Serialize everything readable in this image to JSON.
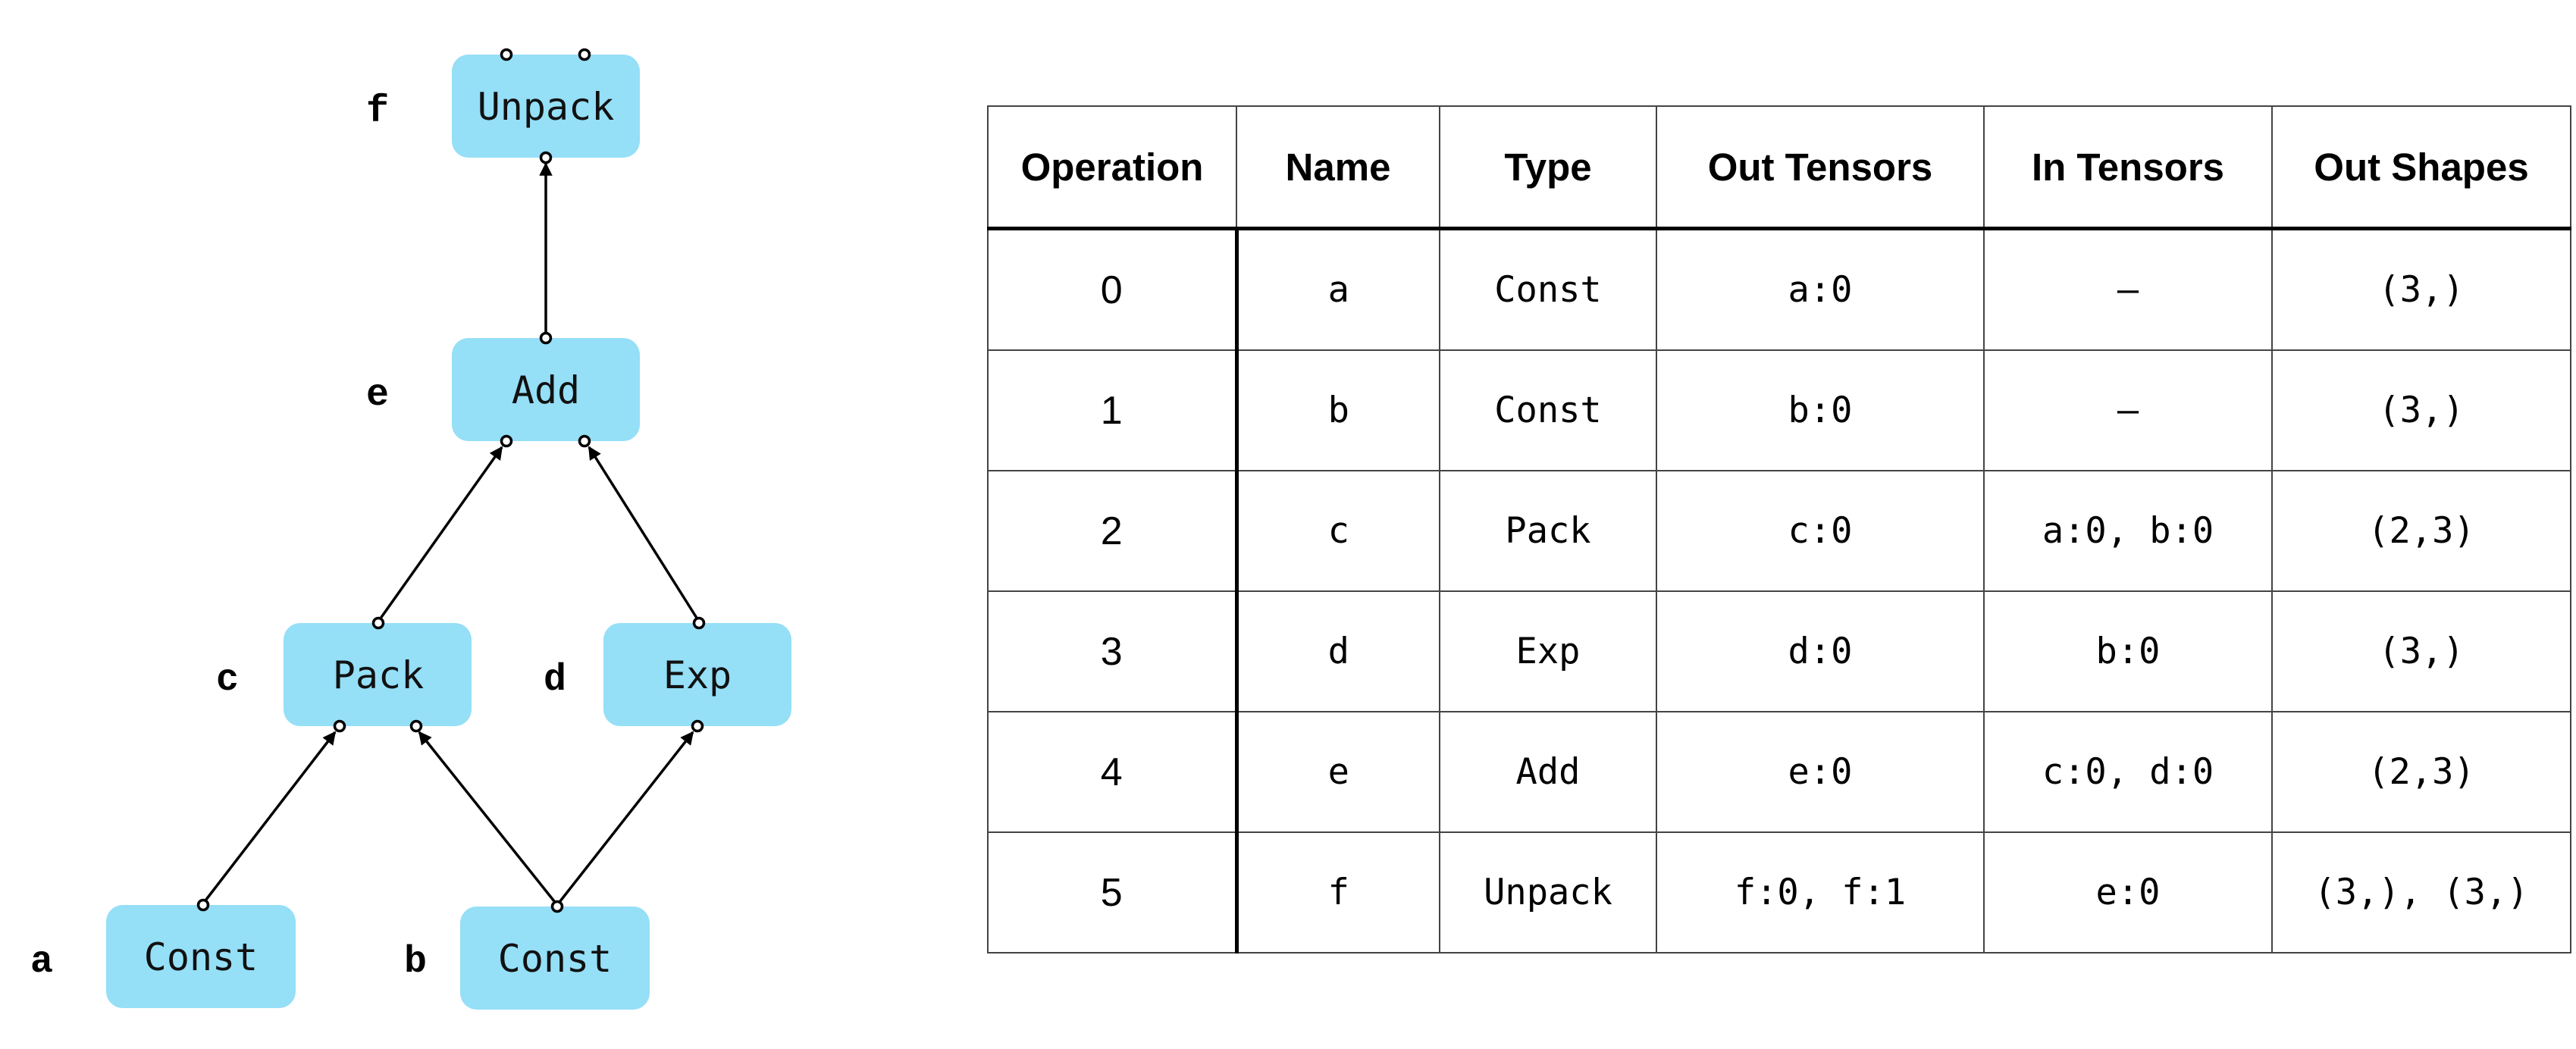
{
  "graph": {
    "nodes": [
      {
        "id": "a",
        "label": "a",
        "text": "Const"
      },
      {
        "id": "b",
        "label": "b",
        "text": "Const"
      },
      {
        "id": "c",
        "label": "c",
        "text": "Pack"
      },
      {
        "id": "d",
        "label": "d",
        "text": "Exp"
      },
      {
        "id": "e",
        "label": "e",
        "text": "Add"
      },
      {
        "id": "f",
        "label": "f",
        "text": "Unpack"
      }
    ],
    "edges": [
      {
        "from": "a",
        "to": "c"
      },
      {
        "from": "b",
        "to": "c"
      },
      {
        "from": "b",
        "to": "d"
      },
      {
        "from": "c",
        "to": "e"
      },
      {
        "from": "d",
        "to": "e"
      },
      {
        "from": "e",
        "to": "f"
      }
    ],
    "colors": {
      "node_fill": "#95dff7",
      "edge": "#000000"
    }
  },
  "table": {
    "headers": [
      "Operation",
      "Name",
      "Type",
      "Out Tensors",
      "In Tensors",
      "Out Shapes"
    ],
    "rows": [
      [
        "0",
        "a",
        "Const",
        "a:0",
        "–",
        "(3,)"
      ],
      [
        "1",
        "b",
        "Const",
        "b:0",
        "–",
        "(3,)"
      ],
      [
        "2",
        "c",
        "Pack",
        "c:0",
        "a:0, b:0",
        "(2,3)"
      ],
      [
        "3",
        "d",
        "Exp",
        "d:0",
        "b:0",
        "(3,)"
      ],
      [
        "4",
        "e",
        "Add",
        "e:0",
        "c:0, d:0",
        "(2,3)"
      ],
      [
        "5",
        "f",
        "Unpack",
        "f:0, f:1",
        "e:0",
        "(3,), (3,)"
      ]
    ]
  }
}
